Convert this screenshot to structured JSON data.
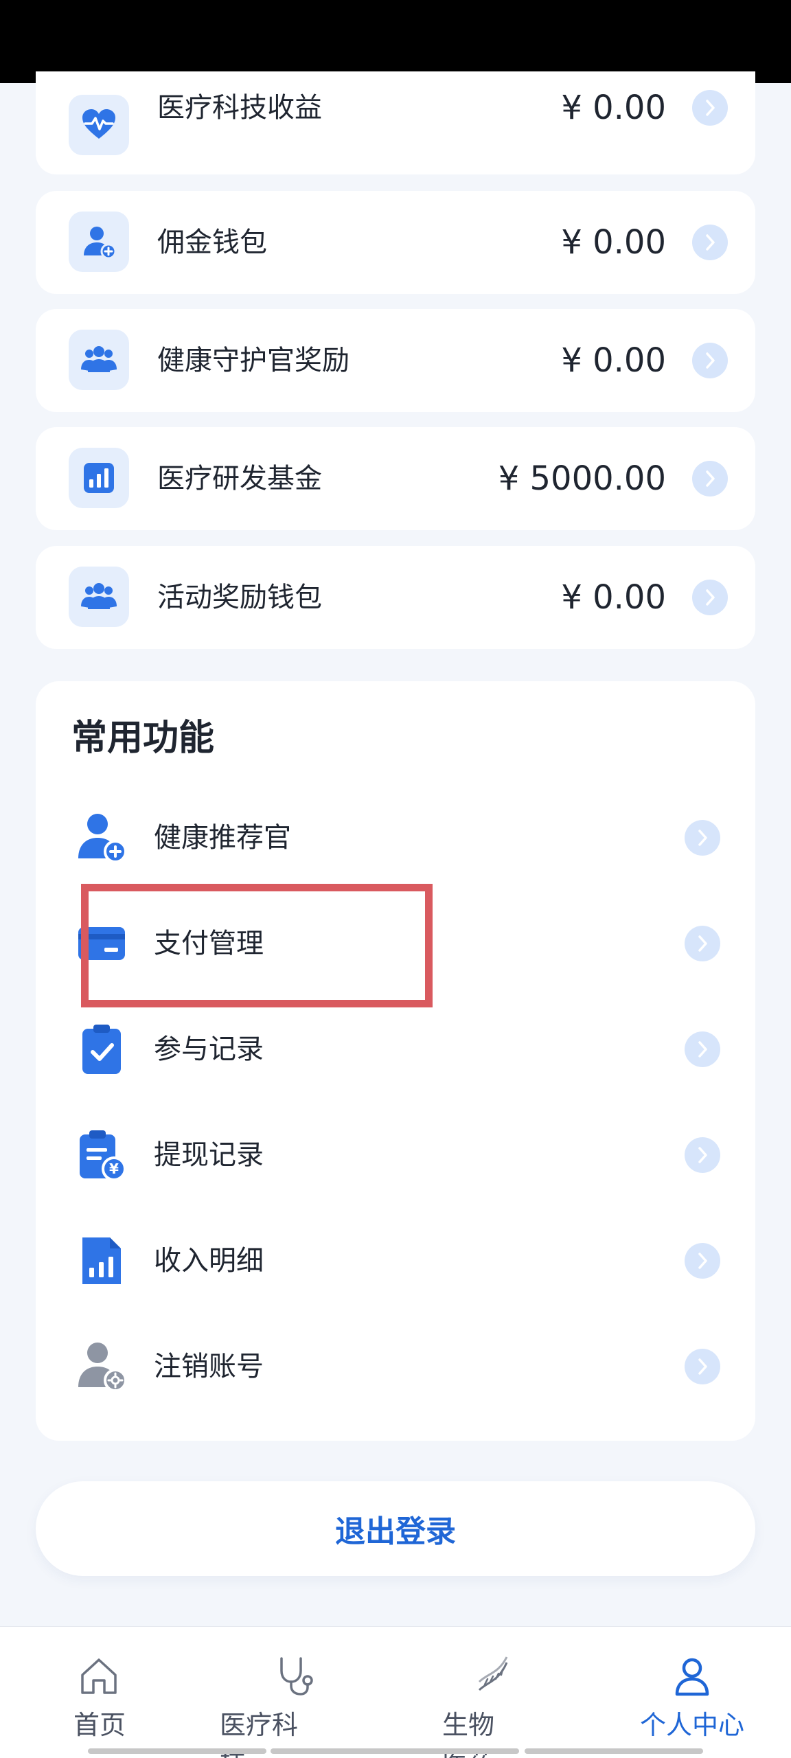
{
  "wallets": [
    {
      "label": "医疗科技收益",
      "amount": "¥ 0.00",
      "icon": "heart-pulse-icon"
    },
    {
      "label": "佣金钱包",
      "amount": "¥ 0.00",
      "icon": "user-plus-icon"
    },
    {
      "label": "健康守护官奖励",
      "amount": "¥ 0.00",
      "icon": "users-group-icon"
    },
    {
      "label": "医疗研发基金",
      "amount": "¥ 5000.00",
      "icon": "bar-chart-icon"
    },
    {
      "label": "活动奖励钱包",
      "amount": "¥ 0.00",
      "icon": "users-group-icon"
    }
  ],
  "functions": {
    "title": "常用功能",
    "items": [
      {
        "label": "健康推荐官",
        "icon": "user-plus-icon"
      },
      {
        "label": "支付管理",
        "icon": "credit-card-icon"
      },
      {
        "label": "参与记录",
        "icon": "clipboard-check-icon"
      },
      {
        "label": "提现记录",
        "icon": "withdraw-record-icon"
      },
      {
        "label": "收入明细",
        "icon": "income-chart-icon"
      },
      {
        "label": "注销账号",
        "icon": "user-settings-icon"
      }
    ]
  },
  "logout": {
    "label": "退出登录"
  },
  "tabs": [
    {
      "label": "首页",
      "icon": "home-icon",
      "active": false
    },
    {
      "label": "医疗科技",
      "icon": "stethoscope-icon",
      "active": false
    },
    {
      "label": "生物医药",
      "icon": "dna-icon",
      "active": false
    },
    {
      "label": "个人中心",
      "icon": "person-icon",
      "active": true
    }
  ],
  "colors": {
    "accent": "#1f66d6",
    "icon_blue": "#2f74e6",
    "icon_bg": "#e5eefc",
    "chevron_bg": "#d7e5fb",
    "highlight": "#d95a5f",
    "page_bg": "#f3f6fb"
  }
}
